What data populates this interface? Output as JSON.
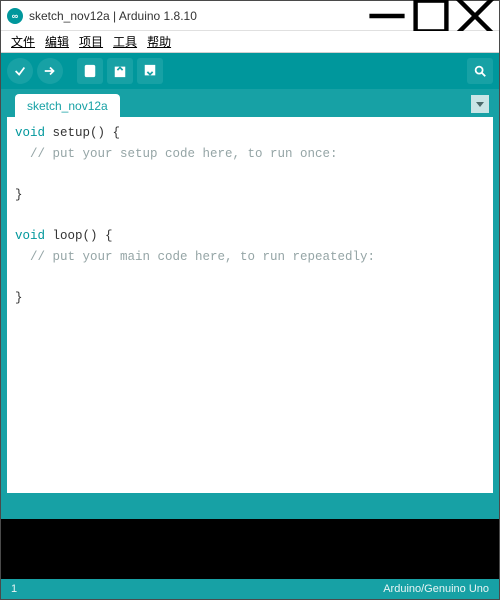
{
  "window": {
    "app_icon_text": "∞",
    "title": "sketch_nov12a | Arduino 1.8.10"
  },
  "menu": {
    "file": "文件",
    "edit": "编辑",
    "sketch": "项目",
    "tools": "工具",
    "help": "帮助"
  },
  "tabs": {
    "active": "sketch_nov12a"
  },
  "code": {
    "line1_kw": "void",
    "line1_rest": " setup() {",
    "line2": "  // put your setup code here, to run once:",
    "line3": "",
    "line4": "}",
    "line5": "",
    "line6_kw": "void",
    "line6_rest": " loop() {",
    "line7": "  // put your main code here, to run repeatedly:",
    "line8": "",
    "line9": "}"
  },
  "status": {
    "line": "1",
    "board": "Arduino/Genuino Uno"
  }
}
